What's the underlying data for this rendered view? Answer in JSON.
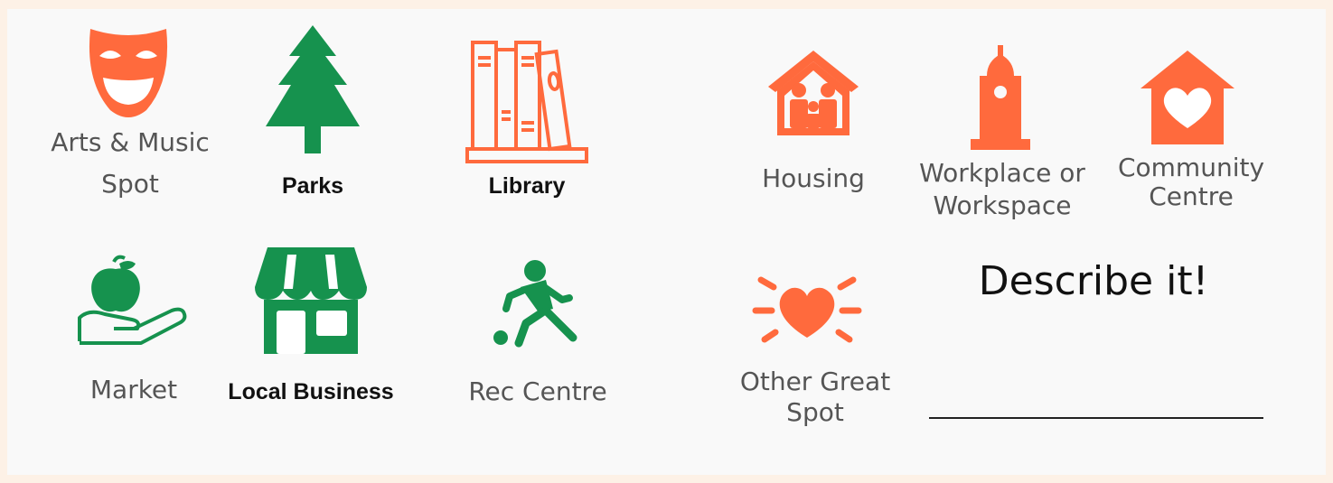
{
  "colors": {
    "orange": "#ff6a3d",
    "green": "#16924e",
    "page_bg": "#fdf1e6",
    "panel_bg": "#f9f9f9"
  },
  "places": {
    "arts": {
      "label_line1": "Arts & Music",
      "label_line2": "Spot",
      "icon": "theater-mask-icon"
    },
    "parks": {
      "label": "Parks",
      "icon": "pine-tree-icon"
    },
    "library": {
      "label": "Library",
      "icon": "books-icon"
    },
    "housing": {
      "label": "Housing",
      "icon": "family-house-icon"
    },
    "workplace": {
      "label_line1": "Workplace or",
      "label_line2": "Workspace",
      "icon": "clock-tower-icon"
    },
    "community": {
      "label_line1": "Community",
      "label_line2": "Centre",
      "icon": "heart-house-icon"
    },
    "market": {
      "label": "Market",
      "icon": "apple-in-hand-icon"
    },
    "local_business": {
      "label": "Local Business",
      "icon": "storefront-icon"
    },
    "rec_centre": {
      "label": "Rec Centre",
      "icon": "soccer-player-icon"
    },
    "other": {
      "label_line1": "Other Great",
      "label_line2": "Spot",
      "icon": "radiant-heart-icon"
    }
  },
  "prompt": {
    "text": "Describe it!"
  }
}
